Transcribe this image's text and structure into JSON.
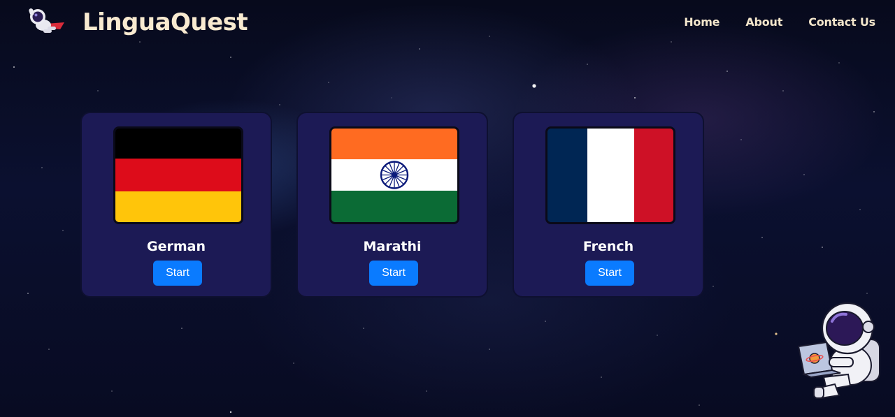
{
  "header": {
    "brand": "LinguaQuest",
    "logo_icon": "flying-astronaut-icon",
    "nav": [
      {
        "label": "Home"
      },
      {
        "label": "About"
      },
      {
        "label": "Contact Us"
      }
    ]
  },
  "languages": [
    {
      "name": "German",
      "flag_icon": "germany-flag-icon",
      "button_label": "Start"
    },
    {
      "name": "Marathi",
      "flag_icon": "india-flag-icon",
      "button_label": "Start"
    },
    {
      "name": "French",
      "flag_icon": "france-flag-icon",
      "button_label": "Start"
    }
  ],
  "decoration": {
    "mascot_icon": "astronaut-with-laptop-icon"
  },
  "colors": {
    "card_bg": "#1c1a55",
    "button_bg": "#0a7bff",
    "brand_text": "#f8ead0",
    "page_bg": "#0b1030"
  }
}
